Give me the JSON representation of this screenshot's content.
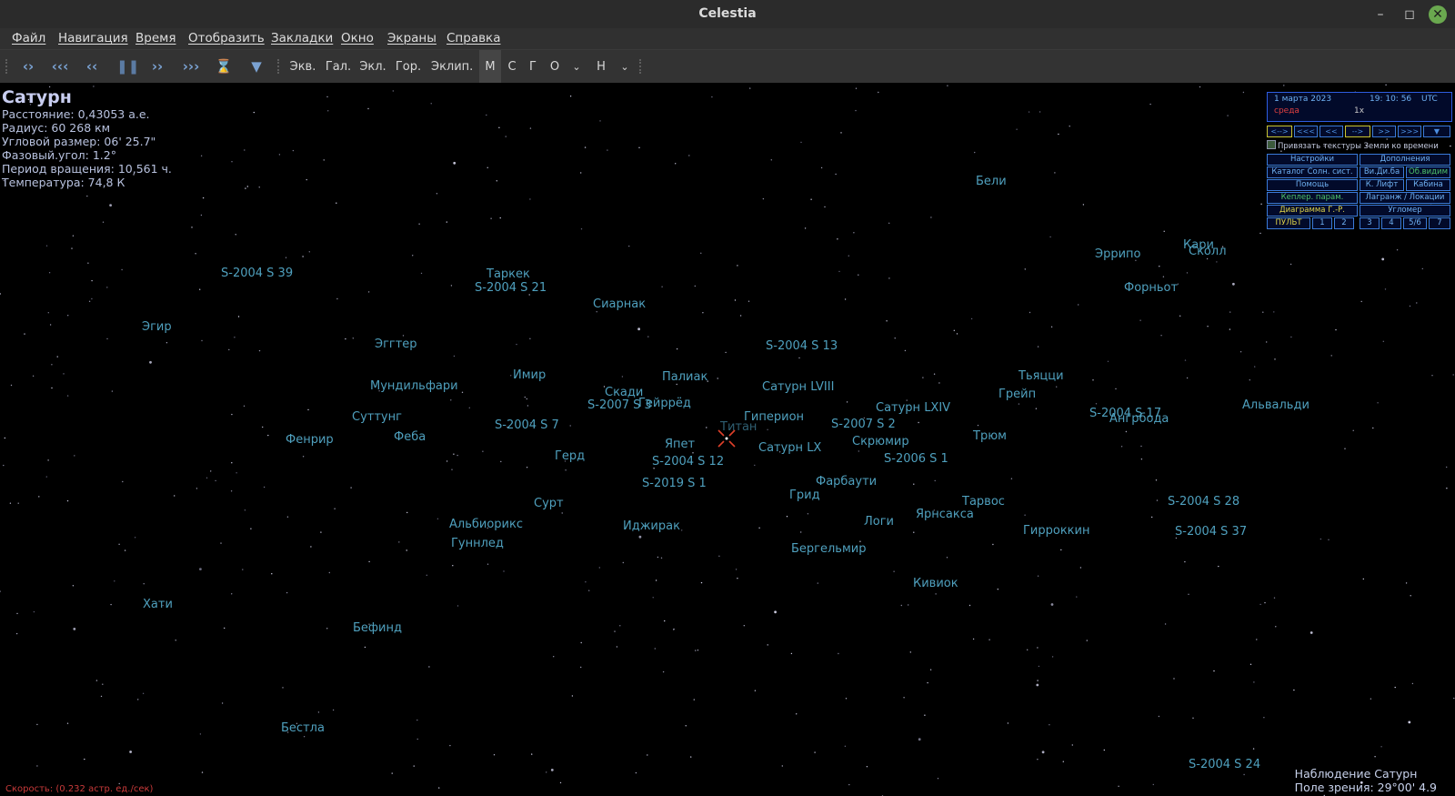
{
  "window": {
    "title": "Celestia",
    "minimize_icon": "minimize-icon",
    "maximize_icon": "maximize-icon",
    "close_icon": "close-icon"
  },
  "menu": [
    "Файл",
    "Навигация",
    "Время",
    "Отобразить",
    "Закладки",
    "Окно",
    "Экраны",
    "Справка"
  ],
  "toolbar": {
    "icons": [
      "reverse-time-icon",
      "fast-rewind-icon",
      "rewind-icon",
      "pause-icon",
      "forward-icon",
      "fast-forward-icon",
      "current-time-icon",
      "filter-icon"
    ],
    "buttons": [
      "Экв.",
      "Гал.",
      "Экл.",
      "Гор.",
      "Эклип.",
      "М",
      "С",
      "Г",
      "О",
      "Н"
    ]
  },
  "info": {
    "name": "Сатурн",
    "distance": "Расстояние: 0,43053 а.е.",
    "radius": "Радиус: 60 268 км",
    "angular_size": "Угловой размер: 06' 25.7\"",
    "phase_angle": "Фазовый.угол: 1.2°",
    "rotation_period": "Период вращения: 10,561 ч.",
    "temperature": "Температура: 74,8 К"
  },
  "panel": {
    "date": "1 марта 2023",
    "time": "19: 10: 56",
    "tz": "UTC",
    "weekday": "среда",
    "rate": "1x",
    "nav_buttons": [
      "<-->",
      "<<<",
      "<<",
      "-->",
      ">>",
      ">>>",
      "filter"
    ],
    "sync_label": "Привязать текстуры Земли ко времени",
    "buttons": {
      "settings": "Настройки",
      "addons": "Дополнения",
      "solar_catalog": "Каталог Солн. сист.",
      "vidiba": "Ви.Ди.ба",
      "obvidim": "Об.видим",
      "help": "Помощь",
      "lift": "К. Лифт",
      "cabin": "Кабина",
      "kepler": "Кеплер. парам.",
      "lagrange": "Лагранж / Локации",
      "hr_diagram": "Диаграмма Г.-Р.",
      "goniometer": "Угломер",
      "pult": "ПУЛЬТ",
      "n1": "1",
      "n2": "2",
      "n3": "3",
      "n4": "4",
      "n56": "5/6",
      "n7": "7"
    }
  },
  "moons": [
    "Бели",
    "Кари",
    "Эррипо",
    "Сколл",
    "S-2004 S 39",
    "Таркек",
    "S-2004 S 21",
    "Форньот",
    "Сиарнак",
    "Эгир",
    "Эггтер",
    "S-2004 S 13",
    "Имир",
    "Палиак",
    "Тьяцци",
    "Мундильфари",
    "Скади",
    "Сатурн LVIII",
    "Грейп",
    "Альвальди",
    "S-2007 S 3",
    "Гейррёд",
    "Сатурн LXIV",
    "S-2004 S 17",
    "Ангрбода",
    "Суттунг",
    "Гиперион",
    "S-2004 S 7",
    "S-2007 S 2",
    "Титан",
    "Фенрир",
    "Феба",
    "Трюм",
    "Скрюмир",
    "Япет",
    "Сатурн LX",
    "Герд",
    "S-2006 S 1",
    "S-2004 S 12",
    "Фарбаути",
    "S-2019 S 1",
    "Грид",
    "Тарвос",
    "S-2004 S 28",
    "Сурт",
    "Ярнсакса",
    "Альбиорикс",
    "Иджирак",
    "Логи",
    "Гирроккин",
    "S-2004 S 37",
    "Гуннлед",
    "Бергельмир",
    "Кивиок",
    "Хати",
    "Бефинд",
    "Бестла",
    "S-2004 S 24"
  ],
  "status": {
    "speed": "Скорость: (0.232 астр. ед./сек)",
    "observe": "Наблюдение Сатурн",
    "fov": "Поле зрения: 29°00' 4.9"
  },
  "colors": {
    "label": "#4fa0be",
    "panel_border": "#2e5de0",
    "panel_text": "#6fb1f3",
    "target": "#e0402a"
  }
}
